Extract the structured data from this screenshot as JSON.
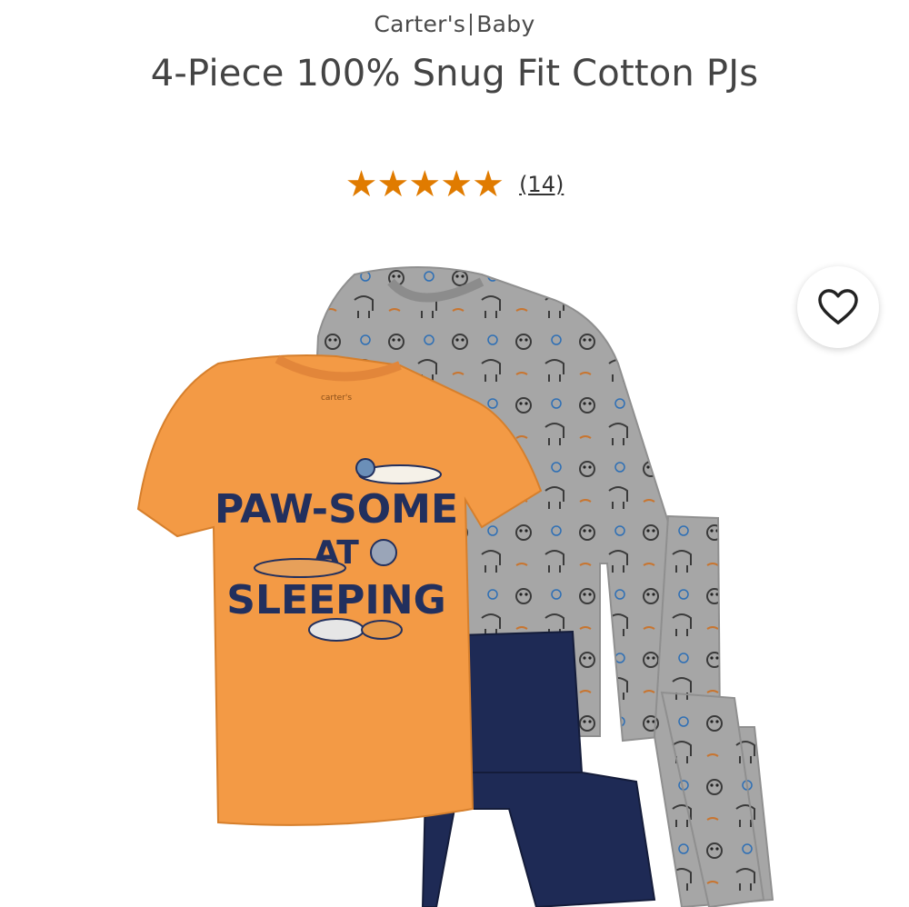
{
  "product": {
    "brand": "Carter's",
    "category": "Baby",
    "title": "4-Piece 100% Snug Fit Cotton PJs",
    "rating_stars": "★★★★★",
    "rating_value": 5,
    "review_count_label": "(14)"
  },
  "shirt_graphic": {
    "line1": "PAW-SOME",
    "line2": "AT",
    "line3": "SLEEPING",
    "label": "carter's"
  },
  "icons": {
    "favorite": "heart-icon"
  },
  "colors": {
    "star": "#e07b00",
    "orange_shirt": "#f39a45",
    "gray_shirt": "#a6a6a6",
    "navy_pants": "#1e2a55",
    "text": "#444444"
  }
}
